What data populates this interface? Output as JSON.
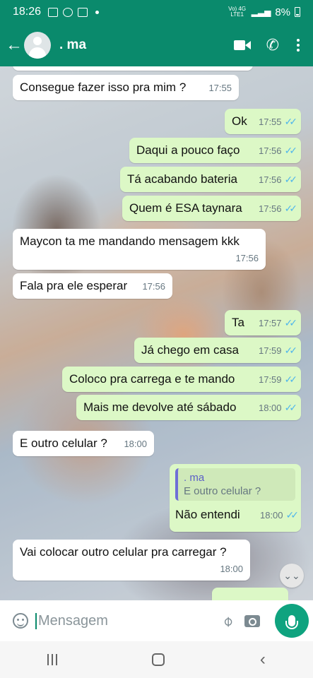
{
  "status_bar": {
    "time": "18:26",
    "network": "Vo) 4G LTE1",
    "battery": "8%"
  },
  "header": {
    "contact_name": ". ma"
  },
  "messages": [
    {
      "dir": "in",
      "text": "Consegue fazer isso pra mim ?",
      "time": "17:55"
    },
    {
      "dir": "out",
      "text": "Ok",
      "time": "17:55"
    },
    {
      "dir": "out",
      "text": "Daqui a pouco faço",
      "time": "17:56"
    },
    {
      "dir": "out",
      "text": "Tá acabando  bateria",
      "time": "17:56"
    },
    {
      "dir": "out",
      "text": "Quem é ESA taynara",
      "time": "17:56"
    },
    {
      "dir": "in",
      "text": "Maycon ta me mandando mensagem kkk",
      "time": "17:56"
    },
    {
      "dir": "in",
      "text": "Fala pra ele esperar",
      "time": "17:56"
    },
    {
      "dir": "out",
      "text": "Ta",
      "time": "17:57"
    },
    {
      "dir": "out",
      "text": "Já chego em casa",
      "time": "17:59"
    },
    {
      "dir": "out",
      "text": "Coloco pra carrega e te mando",
      "time": "17:59"
    },
    {
      "dir": "out",
      "text": "Mais me devolve até sábado",
      "time": "18:00"
    },
    {
      "dir": "in",
      "text": "E outro celular ?",
      "time": "18:00"
    },
    {
      "dir": "out",
      "quote_name": ". ma",
      "quote_text": "E outro celular ?",
      "text": "Não entendi",
      "time": "18:00"
    },
    {
      "dir": "in",
      "text": "Vai colocar outro celular pra carregar ?",
      "time": "18:00"
    }
  ],
  "input": {
    "placeholder": "Mensagem"
  },
  "icons": {
    "back": "back-arrow-icon",
    "video": "video-call-icon",
    "call": "phone-icon",
    "menu": "more-vert-icon",
    "emoji": "emoji-icon",
    "attach": "paperclip-icon",
    "camera": "camera-icon",
    "mic": "mic-icon",
    "scroll": "chevron-double-down-icon"
  },
  "colors": {
    "header": "#0a8a6c",
    "outgoing_bubble": "#dcf8c6",
    "incoming_bubble": "#ffffff",
    "read_ticks": "#4fb6ec",
    "mic_button": "#0fa37f"
  }
}
